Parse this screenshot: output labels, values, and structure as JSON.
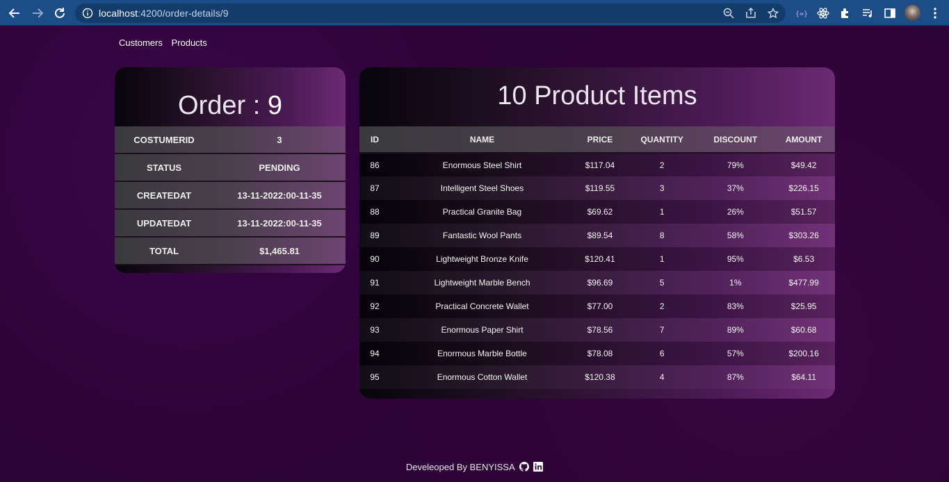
{
  "browser": {
    "url_host": "localhost",
    "url_rest": ":4200/order-details/9"
  },
  "nav": {
    "customers": "Customers",
    "products": "Products"
  },
  "order": {
    "title_label": "Order : ",
    "title_id": "9",
    "rows": [
      {
        "key": "COSTUMERID",
        "value": "3"
      },
      {
        "key": "STATUS",
        "value": "PENDING"
      },
      {
        "key": "CREATEDAT",
        "value": "13-11-2022:00-11-35"
      },
      {
        "key": "UPDATEDAT",
        "value": "13-11-2022:00-11-35"
      },
      {
        "key": "TOTAL",
        "value": "$1,465.81"
      }
    ]
  },
  "items": {
    "title": "10 Product Items",
    "columns": [
      "ID",
      "NAME",
      "PRICE",
      "QUANTITY",
      "DISCOUNT",
      "AMOUNT"
    ],
    "rows": [
      [
        "86",
        "Enormous Steel Shirt",
        "$117.04",
        "2",
        "79%",
        "$49.42"
      ],
      [
        "87",
        "Intelligent Steel Shoes",
        "$119.55",
        "3",
        "37%",
        "$226.15"
      ],
      [
        "88",
        "Practical Granite Bag",
        "$69.62",
        "1",
        "26%",
        "$51.57"
      ],
      [
        "89",
        "Fantastic Wool Pants",
        "$89.54",
        "8",
        "58%",
        "$303.26"
      ],
      [
        "90",
        "Lightweight Bronze Knife",
        "$120.41",
        "1",
        "95%",
        "$6.53"
      ],
      [
        "91",
        "Lightweight Marble Bench",
        "$96.69",
        "5",
        "1%",
        "$477.99"
      ],
      [
        "92",
        "Practical Concrete Wallet",
        "$77.00",
        "2",
        "83%",
        "$25.95"
      ],
      [
        "93",
        "Enormous Paper Shirt",
        "$78.56",
        "7",
        "89%",
        "$60.68"
      ],
      [
        "94",
        "Enormous Marble Bottle",
        "$78.08",
        "6",
        "57%",
        "$200.16"
      ],
      [
        "95",
        "Enormous Cotton Wallet",
        "$120.38",
        "4",
        "87%",
        "$64.11"
      ]
    ]
  },
  "footer": {
    "text": "Develeoped By BENYISSA"
  }
}
